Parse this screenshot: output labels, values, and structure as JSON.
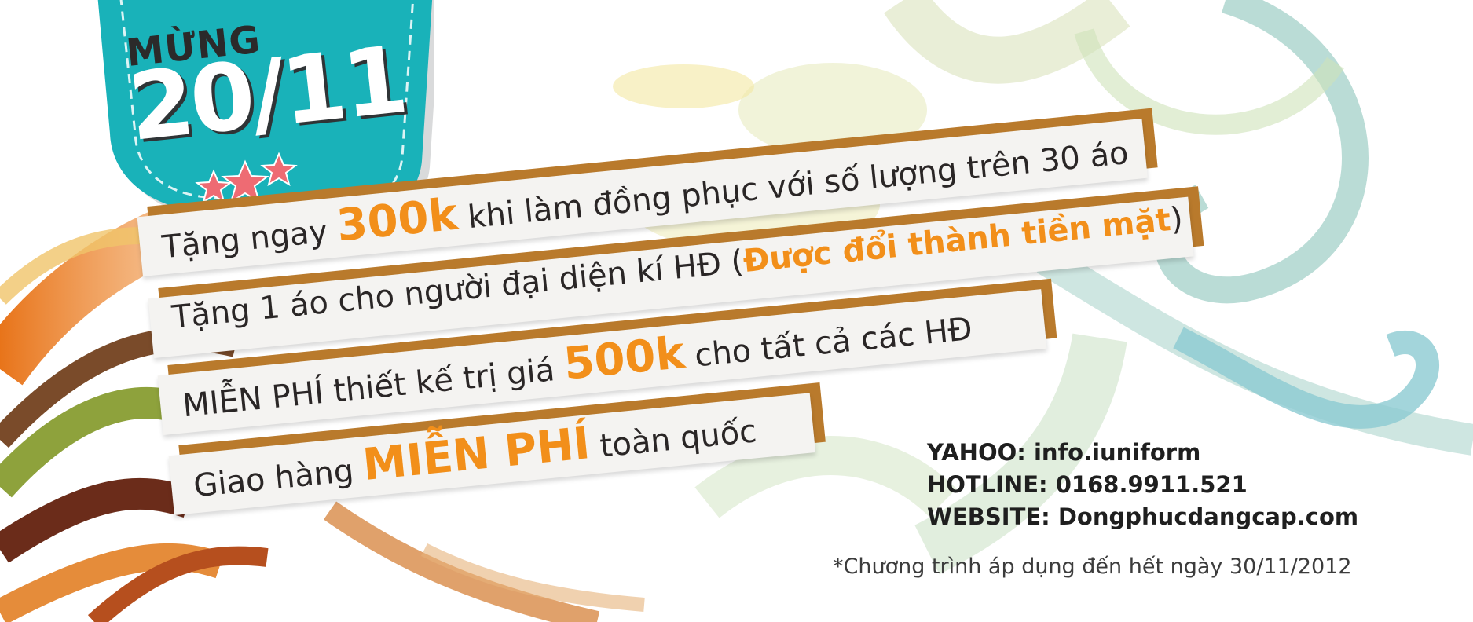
{
  "tag": {
    "line1": "MỪNG",
    "line2": "20/11"
  },
  "promos": [
    {
      "before": "Tặng ngay ",
      "highlight": "300k",
      "after": " khi làm đồng phục với số lượng trên 30 áo"
    },
    {
      "before": "Tặng 1 áo cho người đại diện kí HĐ (",
      "highlight": "Được đổi thành tiền mặt",
      "after": ")"
    },
    {
      "before": "MIỄN PHÍ thiết kế trị giá ",
      "highlight": "500k",
      "after": " cho tất cả các HĐ"
    },
    {
      "before": "Giao hàng ",
      "highlight": "MIỄN PHÍ",
      "after": " toàn quốc"
    }
  ],
  "contact": {
    "yahoo": "YAHOO: info.iuniform",
    "hotline": "HOTLINE: 0168.9911.521",
    "website": "WEBSITE: Dongphucdangcap.com"
  },
  "note": "*Chương trình áp dụng đến hết ngày 30/11/2012",
  "colors": {
    "tag_teal": "#19b2b9",
    "highlight_orange": "#f28f1a",
    "banner_back": "#b97a2c",
    "star_pink": "#ee6b73"
  }
}
